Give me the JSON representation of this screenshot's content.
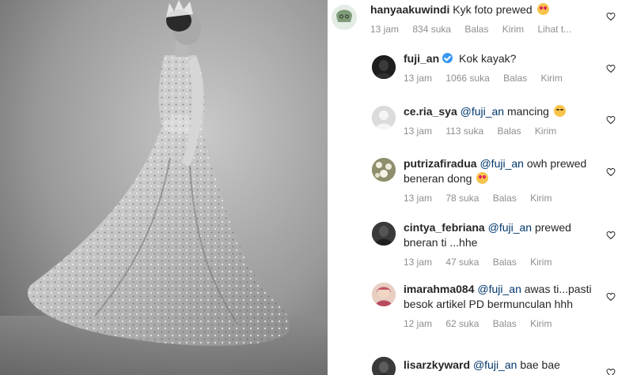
{
  "comments": [
    {
      "username": "hanyaakuwindi",
      "mention": "",
      "text": "Kyk foto prewed",
      "emoji": "heart-eyes",
      "time": "13 jam",
      "likes": "834 suka",
      "reply": "Balas",
      "send": "Kirim",
      "more": "Lihat t..."
    },
    {
      "username": "fuji_an",
      "mention": "",
      "text": "Kok kayak?",
      "time": "13 jam",
      "likes": "1066 suka",
      "reply": "Balas",
      "send": "Kirim"
    },
    {
      "username": "ce.ria_sya",
      "mention": "@fuji_an",
      "text": "mancing",
      "emoji": "laughing",
      "time": "13 jam",
      "likes": "113 suka",
      "reply": "Balas",
      "send": "Kirim"
    },
    {
      "username": "putrizafiradua",
      "mention": "@fuji_an",
      "text": "owh prewed beneran dong",
      "emoji": "heart-eyes",
      "time": "13 jam",
      "likes": "78 suka",
      "reply": "Balas",
      "send": "Kirim"
    },
    {
      "username": "cintya_febriana",
      "mention": "@fuji_an",
      "text": "prewed bneran ti ...hhe",
      "time": "13 jam",
      "likes": "47 suka",
      "reply": "Balas",
      "send": "Kirim"
    },
    {
      "username": "imarahma084",
      "mention": "@fuji_an",
      "text": "awas ti...pasti besok artikel PD bermunculan hhh",
      "time": "12 jam",
      "likes": "62 suka",
      "reply": "Balas",
      "send": "Kirim"
    },
    {
      "username": "lisarzkyward",
      "mention": "@fuji_an",
      "text": "bae bae",
      "time": "",
      "likes": "",
      "reply": "",
      "send": ""
    }
  ]
}
